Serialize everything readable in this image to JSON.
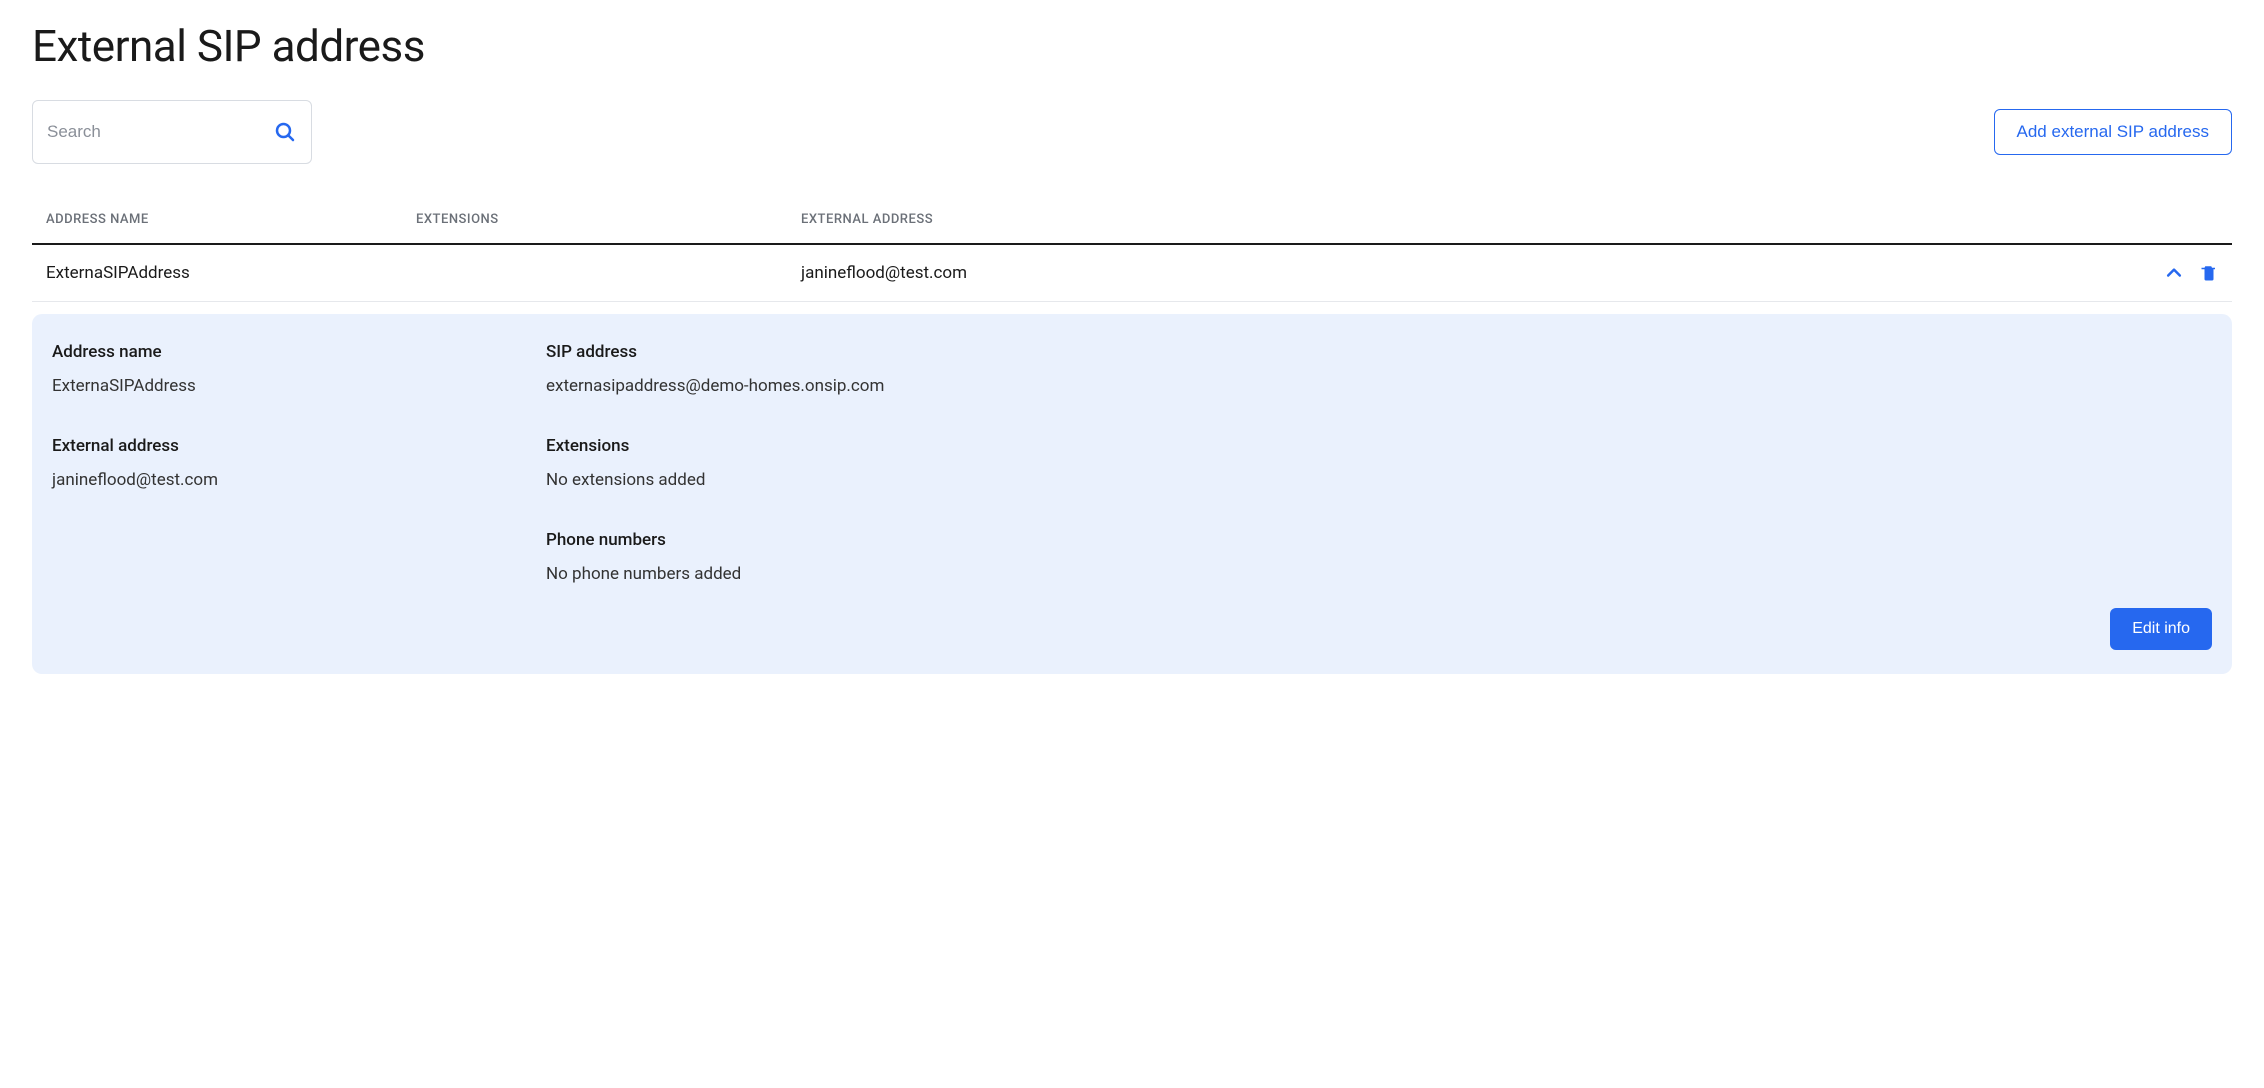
{
  "title": "External SIP address",
  "search": {
    "placeholder": "Search"
  },
  "add_button": "Add external SIP address",
  "columns": {
    "name": "ADDRESS NAME",
    "ext": "EXTENSIONS",
    "addr": "EXTERNAL ADDRESS"
  },
  "rows": [
    {
      "name": "ExternaSIPAddress",
      "ext": "",
      "addr": "janineflood@test.com"
    }
  ],
  "detail": {
    "address_name_label": "Address name",
    "address_name_value": "ExternaSIPAddress",
    "sip_address_label": "SIP address",
    "sip_address_value": "externasipaddress@demo-homes.onsip.com",
    "external_address_label": "External address",
    "external_address_value": "janineflood@test.com",
    "extensions_label": "Extensions",
    "extensions_value": "No extensions added",
    "phone_label": "Phone numbers",
    "phone_value": "No phone numbers added",
    "edit_button": "Edit info"
  }
}
